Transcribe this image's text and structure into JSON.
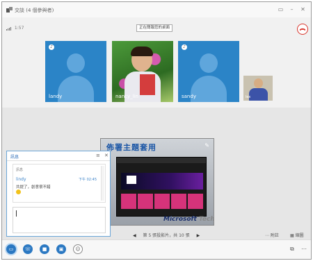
{
  "window": {
    "title": "交談 (4 個參與者)"
  },
  "call": {
    "signal_label": "1:57"
  },
  "presentation_tab": "正在簡報您的桌面",
  "participants": [
    {
      "name": "landy",
      "type": "avatar"
    },
    {
      "name": "nancy_lin",
      "type": "photo"
    },
    {
      "name": "sandy",
      "type": "avatar"
    },
    {
      "name": "lex",
      "type": "small"
    }
  ],
  "slide": {
    "title": "佈署主題套用",
    "footer_brand": "Microsoft",
    "footer_product": "TechNet"
  },
  "pager": {
    "label": "第 5 張投影片，共 10 張"
  },
  "stage_controls": {
    "notes": "附註",
    "thumbnails": "縮圖"
  },
  "im": {
    "title": "訊息",
    "section": "訊息",
    "sender": "lindy",
    "time": "下午 02:45",
    "message": "共提了，創意很不錯"
  },
  "bottom_bar": {
    "chat_icon": "chat-icon",
    "phone_icon": "phone-icon",
    "video_icon": "video-icon",
    "present_icon": "present-icon",
    "people_icon": "people-icon"
  },
  "colors": {
    "tile_blue": "#2b84c7",
    "accent": "#2b78c2",
    "hangup": "#d9342b"
  }
}
